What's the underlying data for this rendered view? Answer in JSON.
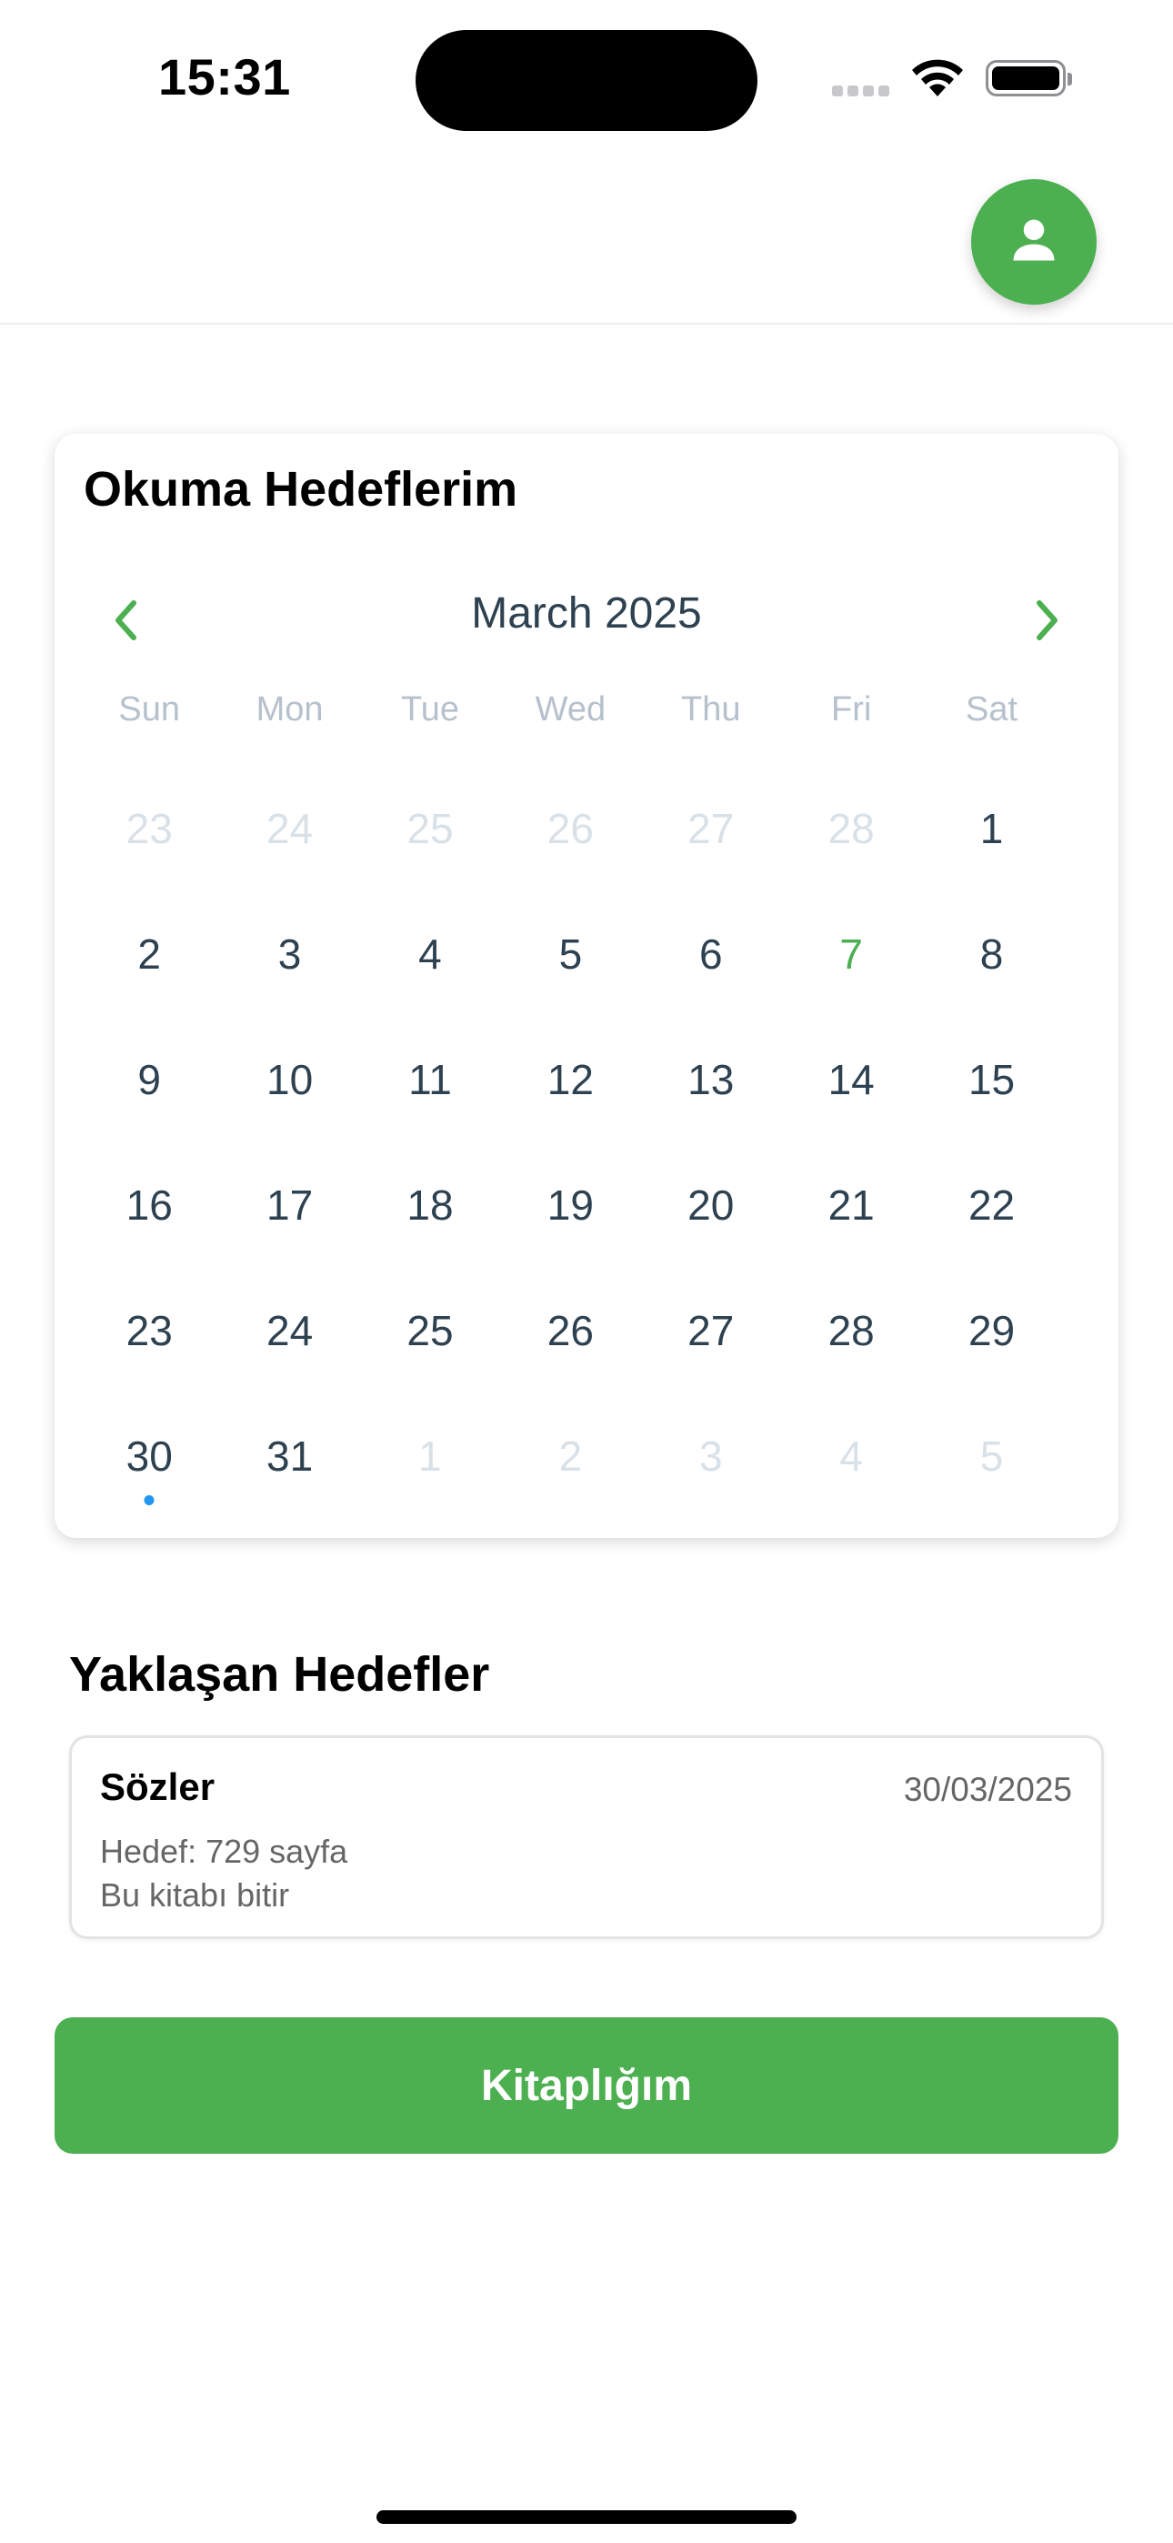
{
  "status_bar": {
    "time": "15:31"
  },
  "header": {
    "profile_icon": "person-icon",
    "accent_color": "#4caf50"
  },
  "calendar": {
    "title": "Okuma Hedeflerim",
    "month_label": "March 2025",
    "prev_icon": "chevron-left-icon",
    "next_icon": "chevron-right-icon",
    "weekdays": [
      "Sun",
      "Mon",
      "Tue",
      "Wed",
      "Thu",
      "Fri",
      "Sat"
    ],
    "weeks": [
      [
        {
          "d": "23",
          "muted": true
        },
        {
          "d": "24",
          "muted": true
        },
        {
          "d": "25",
          "muted": true
        },
        {
          "d": "26",
          "muted": true
        },
        {
          "d": "27",
          "muted": true
        },
        {
          "d": "28",
          "muted": true
        },
        {
          "d": "1"
        }
      ],
      [
        {
          "d": "2"
        },
        {
          "d": "3"
        },
        {
          "d": "4"
        },
        {
          "d": "5"
        },
        {
          "d": "6"
        },
        {
          "d": "7",
          "today": true
        },
        {
          "d": "8"
        }
      ],
      [
        {
          "d": "9"
        },
        {
          "d": "10"
        },
        {
          "d": "11"
        },
        {
          "d": "12"
        },
        {
          "d": "13"
        },
        {
          "d": "14"
        },
        {
          "d": "15"
        }
      ],
      [
        {
          "d": "16"
        },
        {
          "d": "17"
        },
        {
          "d": "18"
        },
        {
          "d": "19"
        },
        {
          "d": "20"
        },
        {
          "d": "21"
        },
        {
          "d": "22"
        }
      ],
      [
        {
          "d": "23"
        },
        {
          "d": "24"
        },
        {
          "d": "25"
        },
        {
          "d": "26"
        },
        {
          "d": "27"
        },
        {
          "d": "28"
        },
        {
          "d": "29"
        }
      ],
      [
        {
          "d": "30",
          "marked": true
        },
        {
          "d": "31"
        },
        {
          "d": "1",
          "muted": true
        },
        {
          "d": "2",
          "muted": true
        },
        {
          "d": "3",
          "muted": true
        },
        {
          "d": "4",
          "muted": true
        },
        {
          "d": "5",
          "muted": true
        }
      ]
    ],
    "today_color": "#4caf50",
    "marker_color": "#2196f3"
  },
  "upcoming": {
    "title": "Yaklaşan Hedefler",
    "goals": [
      {
        "name": "Sözler",
        "date": "30/03/2025",
        "target": "Hedef: 729 sayfa",
        "description": "Bu kitabı bitir"
      }
    ]
  },
  "library_button": {
    "label": "Kitaplığım"
  }
}
